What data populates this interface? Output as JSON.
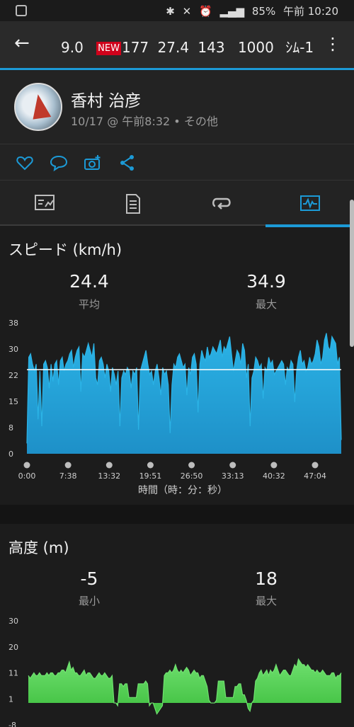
{
  "status": {
    "battery": "85%",
    "time": "午前 10:20"
  },
  "titlebar": {
    "route_parts": [
      "9.0",
      "NEW",
      "177",
      "27.4",
      "143",
      "1000",
      "ｼﾑ-1"
    ]
  },
  "activity": {
    "user_name": "香村 治彦",
    "meta": "10/17 @ 午前8:32 • その他"
  },
  "actions": [
    "heart-icon",
    "comment-icon",
    "camera-add-icon",
    "share-icon"
  ],
  "tabs": [
    "summary-tab",
    "details-tab",
    "laps-tab",
    "charts-tab"
  ],
  "speed": {
    "title": "スピード (km/h)",
    "avg_value": "24.4",
    "avg_label": "平均",
    "max_value": "34.9",
    "max_label": "最大",
    "xlabel": "時間（時：分：秒）"
  },
  "elevation": {
    "title": "高度 (m)",
    "min_value": "-5",
    "min_label": "最小",
    "max_value": "18",
    "max_label": "最大"
  },
  "chart_data": [
    {
      "type": "area",
      "title": "スピード (km/h)",
      "xlabel": "時間（時：分：秒）",
      "ylabel": "",
      "ylim": [
        0,
        38
      ],
      "yticks": [
        "38",
        "30",
        "22",
        "15",
        "8",
        "0"
      ],
      "xticks": [
        "0:00",
        "7:38",
        "13:32",
        "19:51",
        "26:50",
        "33:13",
        "40:32",
        "47:04"
      ],
      "average_line": 24.4,
      "colors": {
        "fill": "#1e90c8",
        "line": "#2bb3e6",
        "avg": "#ffffff"
      },
      "values": [
        3,
        28,
        29,
        26,
        24,
        26,
        10,
        24,
        8,
        26,
        27,
        25,
        19,
        26,
        21,
        26,
        27,
        20,
        27,
        28,
        24,
        26,
        27,
        29,
        30,
        25,
        28,
        30,
        31,
        18,
        29,
        28,
        30,
        32,
        30,
        28,
        32,
        22,
        20,
        27,
        28,
        26,
        22,
        26,
        24,
        18,
        25,
        23,
        20,
        24,
        8,
        22,
        24,
        23,
        25,
        24,
        19,
        24,
        23,
        25,
        7,
        24,
        26,
        28,
        30,
        26,
        23,
        24,
        20,
        24,
        26,
        22,
        17,
        25,
        23,
        24,
        20,
        6,
        20,
        26,
        25,
        28,
        29,
        27,
        25,
        26,
        17,
        25,
        23,
        28,
        29,
        26,
        12,
        26,
        30,
        28,
        27,
        31,
        28,
        29,
        31,
        30,
        29,
        31,
        33,
        28,
        31,
        30,
        32,
        34,
        29,
        24,
        27,
        30,
        29,
        26,
        32,
        30,
        22,
        26,
        8,
        22,
        24,
        28,
        27,
        25,
        26,
        16,
        25,
        24,
        28,
        26,
        27,
        23,
        24,
        25,
        26,
        27,
        26,
        20,
        25,
        24,
        27,
        26,
        15,
        24,
        28,
        30,
        26,
        27,
        24,
        25,
        28,
        26,
        27,
        29,
        33,
        31,
        26,
        28,
        33,
        35,
        31,
        30,
        34,
        33,
        32,
        26,
        28,
        4
      ]
    },
    {
      "type": "area",
      "title": "高度 (m)",
      "ylim": [
        -8,
        30
      ],
      "yticks": [
        "30",
        "20",
        "11",
        "1",
        "-8"
      ],
      "colors": {
        "fill": "#3fbf3f",
        "line": "#6fe06f"
      },
      "values": [
        10,
        9,
        10,
        11,
        10,
        10,
        11,
        10,
        10,
        10,
        11,
        10,
        11,
        11,
        10,
        10,
        11,
        11,
        12,
        12,
        11,
        13,
        15,
        12,
        13,
        11,
        11,
        10,
        10,
        11,
        12,
        10,
        11,
        11,
        10,
        9,
        9,
        10,
        11,
        10,
        10,
        11,
        10,
        9,
        9,
        10,
        0,
        0,
        -1,
        7,
        7,
        6,
        7,
        7,
        2,
        2,
        2,
        2,
        2,
        7,
        7,
        7,
        7,
        8,
        7,
        -1,
        0,
        0,
        -2,
        -4,
        -3,
        -2,
        -1,
        10,
        11,
        11,
        12,
        11,
        12,
        14,
        12,
        11,
        12,
        11,
        12,
        13,
        12,
        10,
        11,
        12,
        11,
        11,
        9,
        10,
        10,
        8,
        6,
        1,
        0,
        0,
        0,
        1,
        8,
        8,
        8,
        8,
        2,
        2,
        2,
        2,
        2,
        6,
        6,
        7,
        7,
        3,
        3,
        1,
        -2,
        -3,
        0,
        1,
        8,
        9,
        11,
        12,
        10,
        11,
        12,
        10,
        12,
        11,
        12,
        14,
        12,
        10,
        11,
        12,
        12,
        11,
        10,
        10,
        12,
        14,
        13,
        16,
        15,
        14,
        14,
        13,
        14,
        13,
        12,
        12,
        11,
        12,
        11,
        11,
        12,
        11,
        10,
        10,
        10,
        11,
        11,
        9,
        10,
        10,
        11
      ]
    }
  ]
}
